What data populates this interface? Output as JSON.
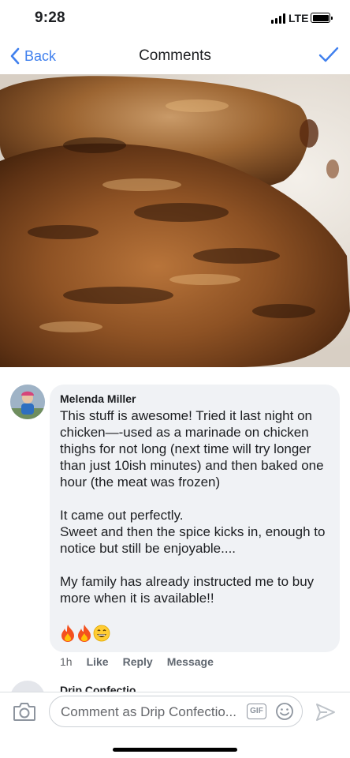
{
  "status_bar": {
    "time": "9:28",
    "network": "LTE",
    "icons": [
      "signal-bars-icon",
      "battery-icon"
    ]
  },
  "nav": {
    "back_label": "Back",
    "title": "Comments",
    "back_icon": "chevron-left-icon",
    "done_icon": "checkmark-icon",
    "accent_color": "#4080ee"
  },
  "post": {
    "photo": "grilled-chicken-photo"
  },
  "comment": {
    "author": "Melenda Miller",
    "body": "This stuff is awesome! Tried it last night on chicken—-used as a marinade on chicken thighs for not long (next time will try longer than just 10ish minutes) and then baked one hour (the meat was frozen)\n\nIt came out perfectly.\nSweet and then the spice kicks in, enough to notice but still be enjoyable....\n\nMy family has already instructed me to buy more when it is available!!",
    "emojis": [
      "🔥",
      "🔥",
      "😄"
    ],
    "time": "1h",
    "actions": {
      "like": "Like",
      "reply": "Reply",
      "message": "Message"
    }
  },
  "next_comment": {
    "author": "Drip Confectio"
  },
  "composer": {
    "placeholder": "Comment as Drip Confectio...",
    "gif_label": "GIF",
    "icons": [
      "camera-icon",
      "gif-icon",
      "smiley-icon",
      "send-icon"
    ]
  }
}
